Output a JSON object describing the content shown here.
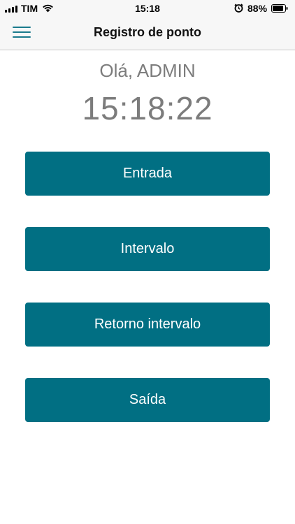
{
  "status_bar": {
    "carrier": "TIM",
    "time": "15:18",
    "battery_percent": "88%",
    "battery_level": 0.88,
    "icons": [
      "signal-icon",
      "wifi-icon",
      "alarm-icon",
      "battery-icon"
    ]
  },
  "nav": {
    "title": "Registro de ponto",
    "menu_icon": "hamburger-menu-icon"
  },
  "main": {
    "greeting": "Olá, ADMIN",
    "clock": "15:18:22"
  },
  "actions": [
    {
      "label": "Entrada"
    },
    {
      "label": "Intervalo"
    },
    {
      "label": "Retorno intervalo"
    },
    {
      "label": "Saída"
    }
  ],
  "colors": {
    "button_bg": "#016f83",
    "button_text": "#ffffff",
    "accent": "#1a7a8c",
    "secondary_text": "#7c7c7c"
  }
}
